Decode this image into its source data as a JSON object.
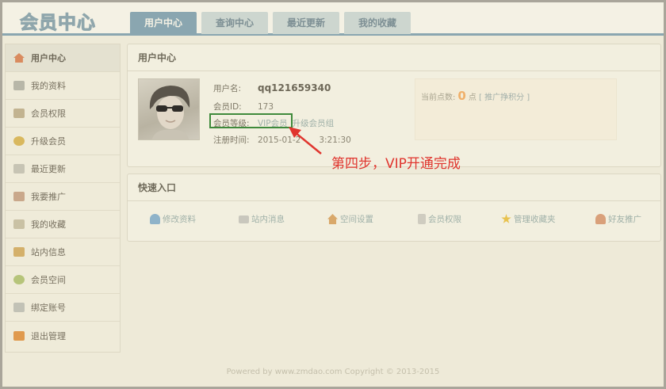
{
  "logo": "会员中心",
  "tabs": [
    {
      "label": "用户中心",
      "active": true
    },
    {
      "label": "查询中心",
      "active": false
    },
    {
      "label": "最近更新",
      "active": false
    },
    {
      "label": "我的收藏",
      "active": false
    }
  ],
  "sidebar": {
    "items": [
      {
        "label": "用户中心",
        "icon": "home-icon",
        "color": "#d98b5f"
      },
      {
        "label": "我的资料",
        "icon": "profile-card-icon",
        "color": "#b8b7a8"
      },
      {
        "label": "会员权限",
        "icon": "book-icon",
        "color": "#c2b390"
      },
      {
        "label": "升级会员",
        "icon": "coins-icon",
        "color": "#d9b85e"
      },
      {
        "label": "最近更新",
        "icon": "document-icon",
        "color": "#c7c4b4"
      },
      {
        "label": "我要推广",
        "icon": "promote-icon",
        "color": "#c9a88b"
      },
      {
        "label": "我的收藏",
        "icon": "favorite-doc-icon",
        "color": "#c9c1a4"
      },
      {
        "label": "站内信息",
        "icon": "mail-icon",
        "color": "#d4b06a"
      },
      {
        "label": "会员空间",
        "icon": "globe-icon",
        "color": "#b6c47a"
      },
      {
        "label": "绑定账号",
        "icon": "grid-icon",
        "color": "#c2c2b6"
      },
      {
        "label": "退出管理",
        "icon": "exit-icon",
        "color": "#e09a4e"
      }
    ]
  },
  "user_panel": {
    "title": "用户中心",
    "username_label": "用户名:",
    "username": "qq121659340",
    "id_label": "会员ID:",
    "id": "173",
    "level_label": "会员等级:",
    "level": "VIP会员",
    "upgrade_link": "升级会员组",
    "reg_label": "注册时间:",
    "reg_time": "2015-01-2",
    "reg_time_tail": "3:21:30",
    "points_label": "当前点数:",
    "points": "0",
    "points_unit": "点",
    "points_link": "[ 推广挣积分 ]"
  },
  "annotation": "第四步，VIP开通完成",
  "quick_panel": {
    "title": "快速入口",
    "items": [
      {
        "label": "修改资料",
        "icon": "user-edit-icon",
        "color": "#8fb3c9"
      },
      {
        "label": "站内消息",
        "icon": "envelope-icon",
        "color": "#c9c7bd"
      },
      {
        "label": "空间设置",
        "icon": "house-icon",
        "color": "#d9a86a"
      },
      {
        "label": "会员权限",
        "icon": "file-icon",
        "color": "#cfccc0"
      },
      {
        "label": "管理收藏夹",
        "icon": "star-icon",
        "color": "#e8c24e"
      },
      {
        "label": "好友推广",
        "icon": "friends-icon",
        "color": "#d9a07a"
      }
    ]
  },
  "footer": "Powered by www.zmdao.com Copyright © 2013-2015",
  "colors": {
    "accent": "#8aa6b0",
    "highlight": "#3f8a3b",
    "annotation": "#e0352e",
    "points": "#f0b06a"
  }
}
